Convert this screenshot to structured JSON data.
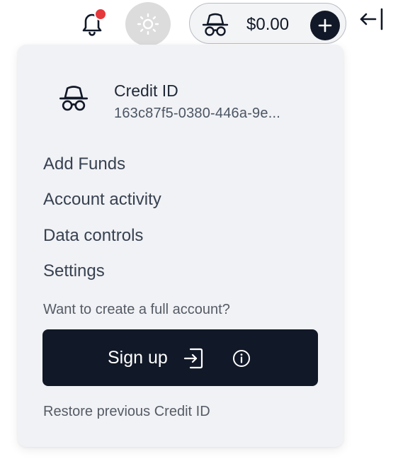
{
  "header": {
    "balance": "$0.00",
    "notification_indicator": true,
    "icons": {
      "notifications": "bell-icon",
      "theme": "sun-icon",
      "account": "incognito-icon",
      "add_funds": "plus-icon",
      "collapse": "arrow-left-to-line-icon"
    },
    "colors": {
      "notification_dot": "#e5383b",
      "theme_button_bg": "#dcdcdc",
      "dark": "#111827"
    }
  },
  "menu": {
    "credit_title": "Credit ID",
    "credit_id": "163c87f5-0380-446a-9e...",
    "items": [
      {
        "label": "Add Funds"
      },
      {
        "label": "Account activity"
      },
      {
        "label": "Data controls"
      },
      {
        "label": "Settings"
      }
    ],
    "prompt": "Want to create a full account?",
    "signup_label": "Sign up",
    "restore_label": "Restore previous Credit ID",
    "icons": {
      "account": "incognito-icon",
      "signup": "enter-icon",
      "info": "info-icon"
    },
    "colors": {
      "background": "#f1f2f5",
      "button": "#111827"
    }
  }
}
